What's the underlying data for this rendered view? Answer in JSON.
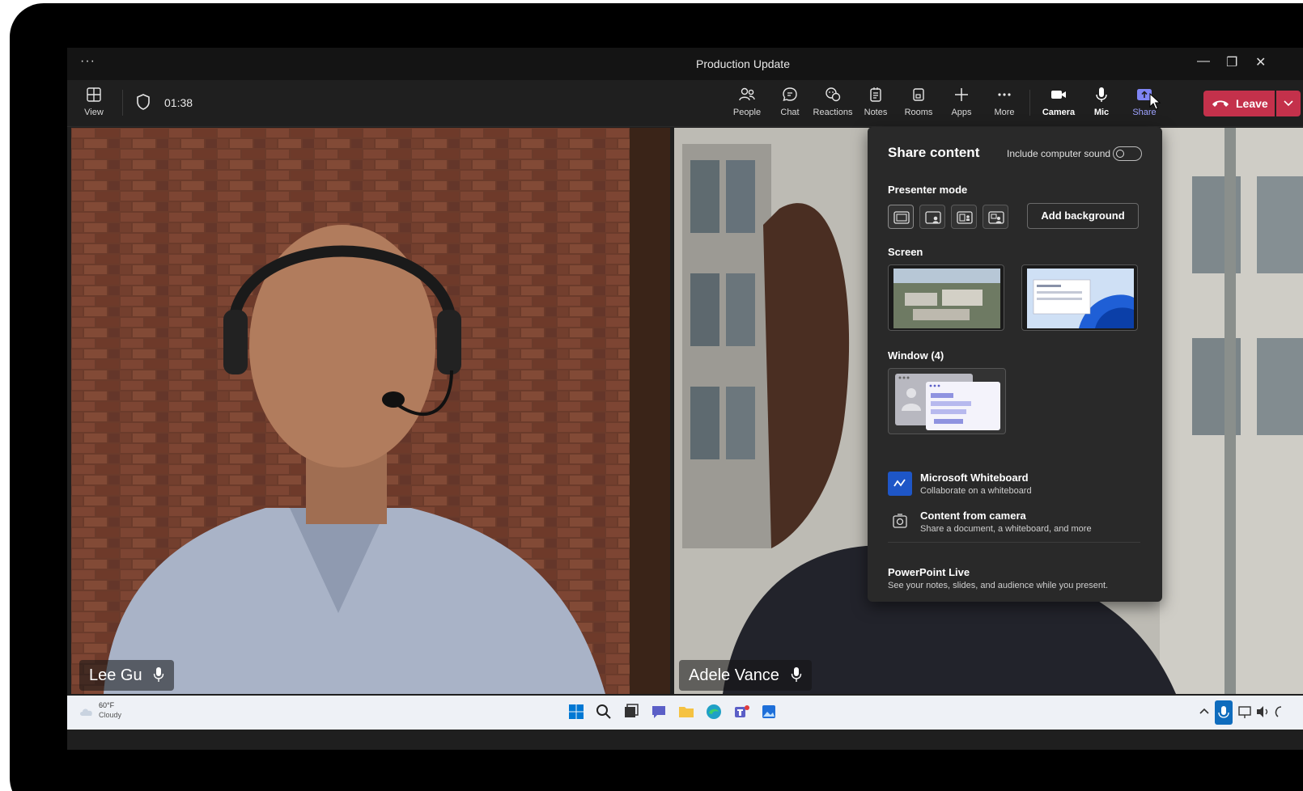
{
  "window": {
    "title": "Production Update",
    "menu_glyph": "···"
  },
  "toolbar": {
    "view_label": "View",
    "timer": "01:38",
    "items": [
      {
        "label": "People",
        "icon": "people-icon"
      },
      {
        "label": "Chat",
        "icon": "chat-icon"
      },
      {
        "label": "Reactions",
        "icon": "reactions-icon"
      },
      {
        "label": "Notes",
        "icon": "notes-icon"
      },
      {
        "label": "Rooms",
        "icon": "rooms-icon"
      },
      {
        "label": "Apps",
        "icon": "apps-icon"
      },
      {
        "label": "More",
        "icon": "more-icon"
      }
    ],
    "camera_label": "Camera",
    "mic_label": "Mic",
    "share_label": "Share",
    "leave_label": "Leave"
  },
  "participants": [
    {
      "name": "Lee Gu"
    },
    {
      "name": "Adele Vance"
    }
  ],
  "share_panel": {
    "title": "Share content",
    "include_sound_label": "Include computer sound",
    "include_sound_on": false,
    "presenter_mode_label": "Presenter mode",
    "add_background_label": "Add background",
    "screen_label": "Screen",
    "window_label": "Window (4)",
    "options": [
      {
        "title": "Microsoft Whiteboard",
        "subtitle": "Collaborate on a whiteboard"
      },
      {
        "title": "Content from camera",
        "subtitle": "Share a document, a whiteboard, and more"
      }
    ],
    "powerpoint": {
      "title": "PowerPoint Live",
      "subtitle": "See your notes, slides, and audience while you present."
    }
  },
  "taskbar": {
    "temp": "60°F",
    "condition": "Cloudy"
  },
  "colors": {
    "leave": "#c4314b",
    "share_active": "#7f85f5",
    "whiteboard": "#1e56c7"
  }
}
